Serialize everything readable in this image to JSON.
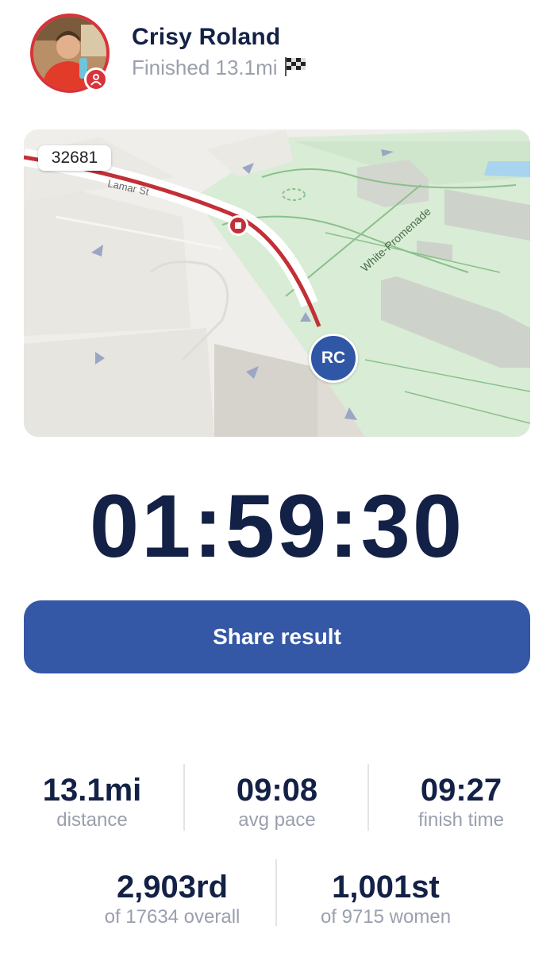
{
  "runner": {
    "name": "Crisy Roland",
    "status": "Finished 13.1mi",
    "initials": "RC",
    "bib": "32681"
  },
  "map": {
    "streets": [
      "Lamar St",
      "White-Promenade"
    ]
  },
  "timer": "01:59:30",
  "share_label": "Share result",
  "stats": [
    {
      "value": "13.1mi",
      "label": "distance"
    },
    {
      "value": "09:08",
      "label": "avg pace"
    },
    {
      "value": "09:27",
      "label": "finish time"
    }
  ],
  "ranks": [
    {
      "value": "2,903rd",
      "label": "of 17634 overall"
    },
    {
      "value": "1,001st",
      "label": "of 9715 women"
    }
  ],
  "colors": {
    "accent_red": "#d8333a",
    "primary_blue": "#3457a6",
    "text_dark": "#142146",
    "text_muted": "#9a9fad"
  }
}
